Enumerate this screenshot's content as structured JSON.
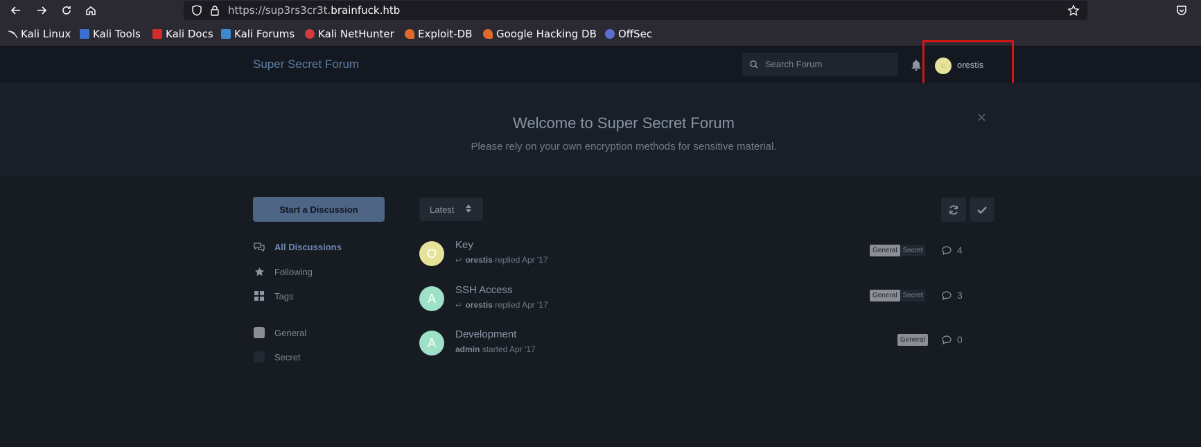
{
  "browser": {
    "url_prefix": "https://sup3rs3cr3t.",
    "url_domain": "brainfuck.htb",
    "bookmarks": [
      {
        "label": "Kali Linux",
        "icon": "kali-dragon-icon",
        "color": "#c9c9c9"
      },
      {
        "label": "Kali Tools",
        "icon": "kali-tools-icon",
        "color": "#3b6fd1"
      },
      {
        "label": "Kali Docs",
        "icon": "kali-docs-icon",
        "color": "#d42b2b"
      },
      {
        "label": "Kali Forums",
        "icon": "kali-forums-icon",
        "color": "#3b8ad1"
      },
      {
        "label": "Kali NetHunter",
        "icon": "nethunter-icon",
        "color": "#d13b3b"
      },
      {
        "label": "Exploit-DB",
        "icon": "exploit-db-icon",
        "color": "#e06a2b"
      },
      {
        "label": "Google Hacking DB",
        "icon": "ghdb-icon",
        "color": "#e06a2b"
      },
      {
        "label": "OffSec",
        "icon": "offsec-icon",
        "color": "#5a6fd1"
      }
    ]
  },
  "header": {
    "forum_title": "Super Secret Forum",
    "search_placeholder": "Search Forum",
    "username": "orestis",
    "avatar_letter": "o"
  },
  "hero": {
    "title": "Welcome to Super Secret Forum",
    "subtitle": "Please rely on your own encryption methods for sensitive material.",
    "close": "×"
  },
  "sidebar": {
    "start_button": "Start a Discussion",
    "nav": [
      {
        "label": "All Discussions",
        "icon": "comments-icon"
      },
      {
        "label": "Following",
        "icon": "star-icon"
      },
      {
        "label": "Tags",
        "icon": "tags-grid-icon"
      }
    ],
    "tags": [
      {
        "label": "General",
        "color": "#8b8f95"
      },
      {
        "label": "Secret",
        "color": "#222831"
      }
    ]
  },
  "toolbar": {
    "sort_label": "Latest"
  },
  "discussions": [
    {
      "title": "Key",
      "avatar": "O",
      "avatar_color": "#e6e29a",
      "user": "orestis",
      "action": "replied",
      "date": "Apr '17",
      "is_reply": true,
      "tags": [
        "General",
        "Secret"
      ],
      "replies": "4"
    },
    {
      "title": "SSH Access",
      "avatar": "A",
      "avatar_color": "#9ee0c8",
      "user": "orestis",
      "action": "replied",
      "date": "Apr '17",
      "is_reply": true,
      "tags": [
        "General",
        "Secret"
      ],
      "replies": "3"
    },
    {
      "title": "Development",
      "avatar": "A",
      "avatar_color": "#9ee0c8",
      "user": "admin",
      "action": "started",
      "date": "Apr '17",
      "is_reply": false,
      "tags": [
        "General"
      ],
      "replies": "0"
    }
  ]
}
